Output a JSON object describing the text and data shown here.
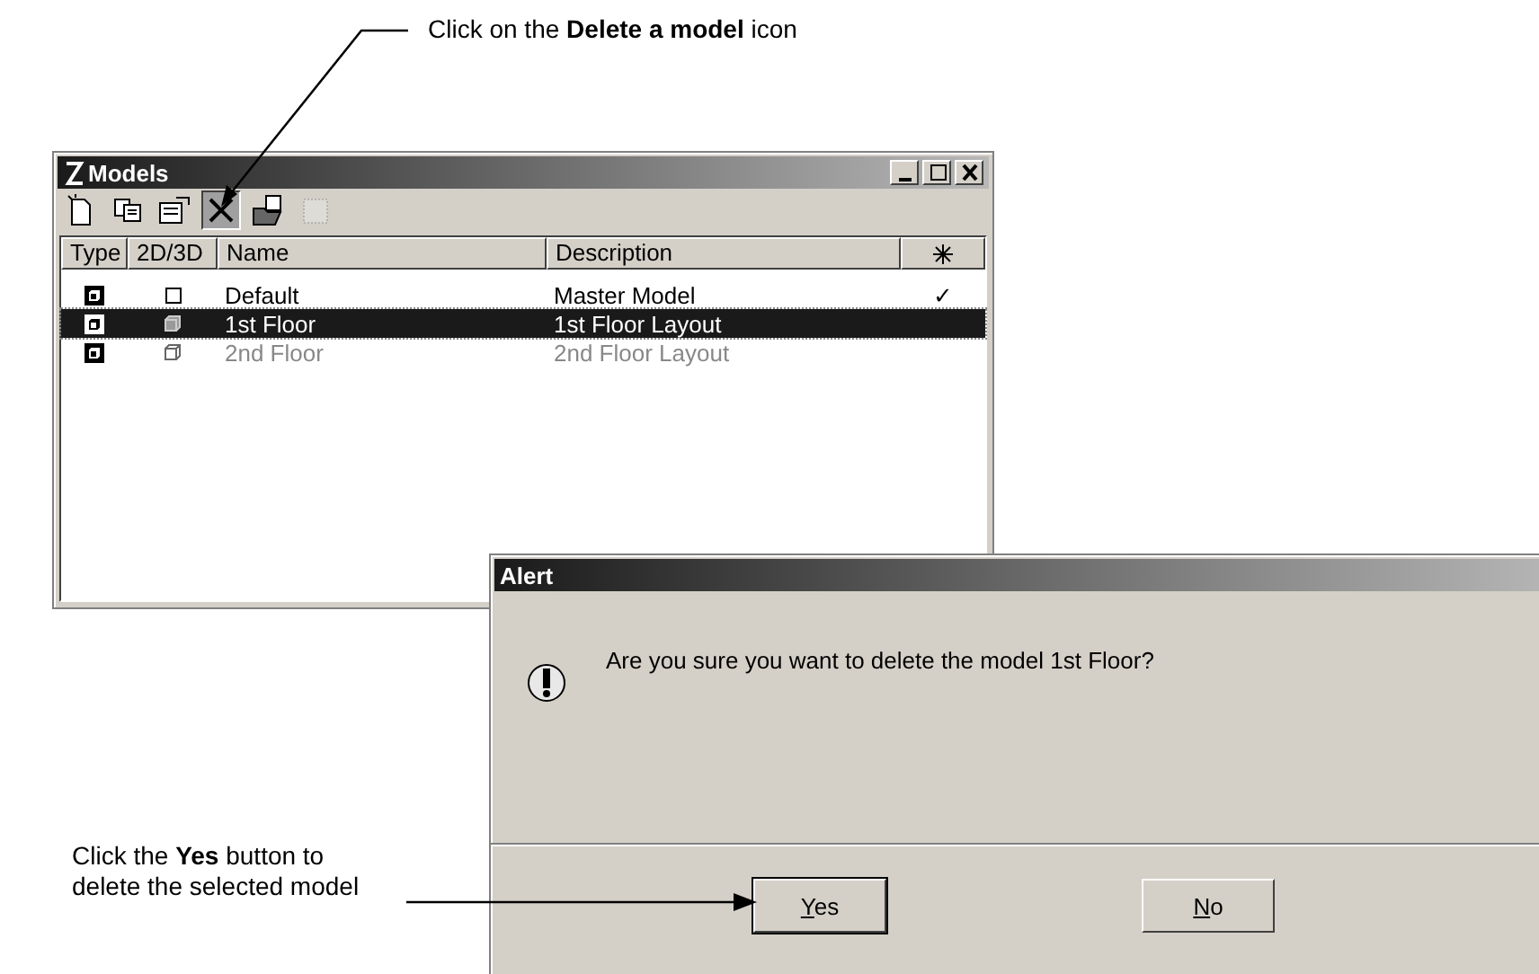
{
  "callouts": [
    {
      "text": "Click on the **Delete a model** icon"
    },
    {
      "text": "Click the **Yes** button to delete the selected model"
    }
  ],
  "models_window": {
    "title": "Models",
    "controls": [
      {
        "kind": "minimize"
      },
      {
        "kind": "maximize"
      },
      {
        "kind": "close"
      }
    ],
    "toolbar": [
      {
        "kind": "new",
        "selected": false,
        "disabled": false
      },
      {
        "kind": "copy",
        "selected": false,
        "disabled": false
      },
      {
        "kind": "properties",
        "selected": false,
        "disabled": false
      },
      {
        "kind": "delete",
        "selected": true,
        "disabled": false
      },
      {
        "kind": "import",
        "selected": false,
        "disabled": false
      },
      {
        "kind": "new-from-seed",
        "selected": false,
        "disabled": true
      }
    ],
    "columns": [
      "Type",
      "2D/3D",
      "Name",
      "Description"
    ],
    "rows": [
      {
        "kind": "flat",
        "name": "Default",
        "description": "Master Model",
        "active": "✓",
        "selected": false,
        "disabled": false
      },
      {
        "kind": "solid",
        "name": "1st Floor",
        "description": "1st Floor Layout",
        "selected": true,
        "disabled": false
      },
      {
        "kind": "wireframe",
        "name": "2nd Floor",
        "description": "2nd Floor Layout",
        "selected": false,
        "disabled": true
      }
    ]
  },
  "alert": {
    "title": "Alert",
    "message": "Are you sure you want to delete the model 1st Floor?",
    "buttons": [
      {
        "label": "Yes",
        "default": true
      },
      {
        "label": "No",
        "default": false
      }
    ]
  }
}
